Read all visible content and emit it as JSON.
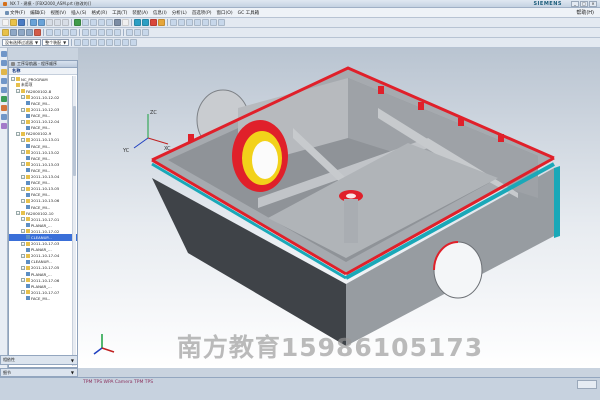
{
  "window": {
    "title": "NX 7 - 建模 - [FBX2000_ASM.prt (修改的)]",
    "brand": "SIEMENS",
    "controls": [
      "_",
      "□",
      "×"
    ]
  },
  "menubar": {
    "items": [
      "文件(F)",
      "编辑(E)",
      "视图(V)",
      "插入(S)",
      "格式(R)",
      "工具(T)",
      "装配(A)",
      "信息(I)",
      "分析(L)",
      "首选项(P)",
      "窗口(O)",
      "GC 工具箱",
      "帮助(H)"
    ],
    "help": "帮助(H)"
  },
  "toolbar": {
    "filter_label": "没有选择过滤器",
    "assembly_label": "整个装配"
  },
  "navigator": {
    "header": "工序导航器 - 程序顺序",
    "tab_label": "名称",
    "tree": [
      {
        "label": "NC_PROGRAM",
        "indent": 0,
        "expander": "-",
        "icon": "folder"
      },
      {
        "label": "未用项",
        "indent": 1,
        "expander": "",
        "icon": "folder"
      },
      {
        "label": "FA2000102-8",
        "indent": 1,
        "expander": "-",
        "icon": "program"
      },
      {
        "label": "2011-10-12-02",
        "indent": 2,
        "expander": "-",
        "icon": "program"
      },
      {
        "label": "FACE_MI...",
        "indent": 3,
        "expander": "",
        "icon": "op"
      },
      {
        "label": "2011-10-12-03",
        "indent": 2,
        "expander": "-",
        "icon": "program"
      },
      {
        "label": "FACE_MI...",
        "indent": 3,
        "expander": "",
        "icon": "op"
      },
      {
        "label": "2011-10-12-04",
        "indent": 2,
        "expander": "-",
        "icon": "program"
      },
      {
        "label": "FACE_MI...",
        "indent": 3,
        "expander": "",
        "icon": "op"
      },
      {
        "label": "FA2000102-9",
        "indent": 1,
        "expander": "-",
        "icon": "program"
      },
      {
        "label": "2011-10-13-01",
        "indent": 2,
        "expander": "-",
        "icon": "program"
      },
      {
        "label": "FACE_MI...",
        "indent": 3,
        "expander": "",
        "icon": "op"
      },
      {
        "label": "2011-10-13-02",
        "indent": 2,
        "expander": "-",
        "icon": "program"
      },
      {
        "label": "FACE_MI...",
        "indent": 3,
        "expander": "",
        "icon": "op"
      },
      {
        "label": "2011-10-13-03",
        "indent": 2,
        "expander": "-",
        "icon": "program"
      },
      {
        "label": "FACE_MI...",
        "indent": 3,
        "expander": "",
        "icon": "op"
      },
      {
        "label": "2011-10-13-04",
        "indent": 2,
        "expander": "-",
        "icon": "program"
      },
      {
        "label": "FACE_MI...",
        "indent": 3,
        "expander": "",
        "icon": "op"
      },
      {
        "label": "2011-10-13-05",
        "indent": 2,
        "expander": "-",
        "icon": "program"
      },
      {
        "label": "FACE_MI...",
        "indent": 3,
        "expander": "",
        "icon": "op"
      },
      {
        "label": "2011-10-13-06",
        "indent": 2,
        "expander": "-",
        "icon": "program"
      },
      {
        "label": "FACE_MI...",
        "indent": 3,
        "expander": "",
        "icon": "op"
      },
      {
        "label": "FA2000102-10",
        "indent": 1,
        "expander": "-",
        "icon": "program"
      },
      {
        "label": "2011-10-17-01",
        "indent": 2,
        "expander": "-",
        "icon": "program"
      },
      {
        "label": "PLANAR_...",
        "indent": 3,
        "expander": "",
        "icon": "op"
      },
      {
        "label": "2011-10-17-02",
        "indent": 2,
        "expander": "-",
        "icon": "program"
      },
      {
        "label": "CLEANUP...",
        "indent": 3,
        "expander": "",
        "icon": "op",
        "selected": true
      },
      {
        "label": "2011-10-17-03",
        "indent": 2,
        "expander": "-",
        "icon": "program"
      },
      {
        "label": "PLANAR_...",
        "indent": 3,
        "expander": "",
        "icon": "op"
      },
      {
        "label": "2011-10-17-04",
        "indent": 2,
        "expander": "-",
        "icon": "program"
      },
      {
        "label": "CLEANUP...",
        "indent": 3,
        "expander": "",
        "icon": "op"
      },
      {
        "label": "2011-10-17-05",
        "indent": 2,
        "expander": "-",
        "icon": "program"
      },
      {
        "label": "PLANAR_...",
        "indent": 3,
        "expander": "",
        "icon": "op"
      },
      {
        "label": "2011-10-17-06",
        "indent": 2,
        "expander": "-",
        "icon": "program"
      },
      {
        "label": "PLANAR_...",
        "indent": 3,
        "expander": "",
        "icon": "op"
      },
      {
        "label": "2011-10-17-07",
        "indent": 2,
        "expander": "-",
        "icon": "program"
      },
      {
        "label": "FACE_MI...",
        "indent": 3,
        "expander": "",
        "icon": "op"
      }
    ],
    "panel_dependencies": "相依性",
    "panel_details": "细节"
  },
  "status": {
    "text": "TPM TPS WPA Camera TPM TPS"
  },
  "watermark": "南方教育15986105173",
  "triad": {
    "x": "XC",
    "y": "YC",
    "z": "ZC"
  },
  "colors": {
    "machined_face_red": "#e0202a",
    "finished_face_cyan": "#1aa8b8",
    "casting_grey": "#a3a7ac",
    "bore_yellow": "#f2d21a",
    "selected_row": "#3a6fd8"
  }
}
